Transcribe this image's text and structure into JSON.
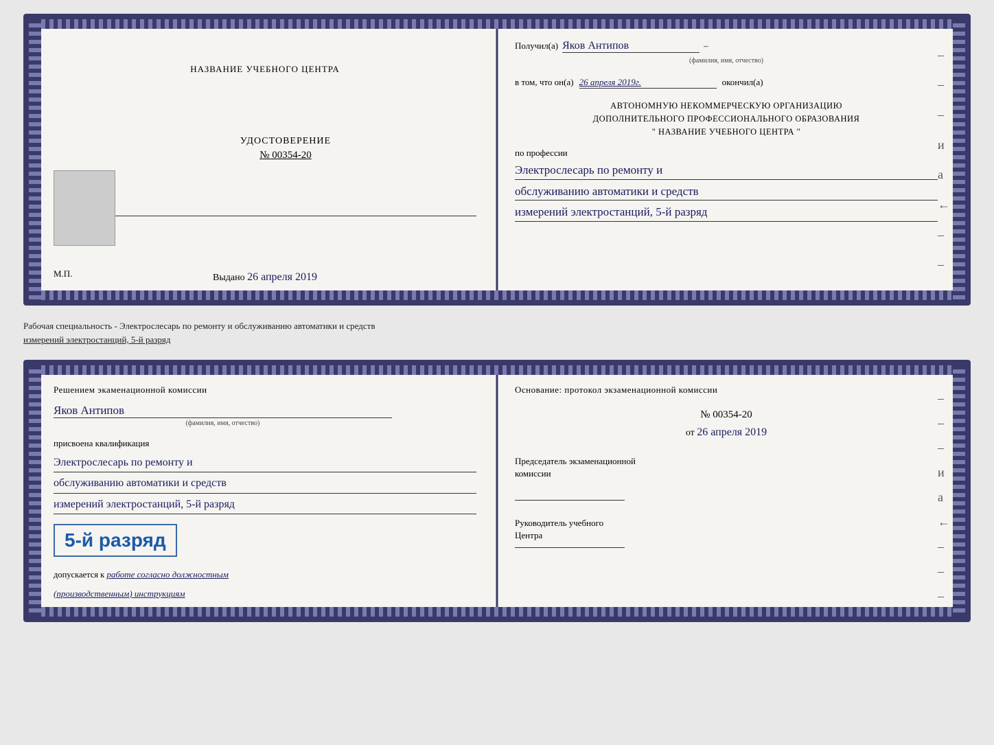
{
  "topDoc": {
    "left": {
      "orgName": "НАЗВАНИЕ УЧЕБНОГО ЦЕНТРА",
      "certTitle": "УДОСТОВЕРЕНИЕ",
      "certNumber": "№ 00354-20",
      "issuedLabel": "Выдано",
      "issuedDate": "26 апреля 2019",
      "mpLabel": "М.П."
    },
    "right": {
      "receivedLabel": "Получил(а)",
      "recipientName": "Яков Антипов",
      "fioSub": "(фамилия, имя, отчество)",
      "certifyText1": "в том, что он(а)",
      "certifyDate": "26 апреля 2019г.",
      "certifyText2": "окончил(а)",
      "orgDesc1": "АВТОНОМНУЮ НЕКОММЕРЧЕСКУЮ ОРГАНИЗАЦИЮ",
      "orgDesc2": "ДОПОЛНИТЕЛЬНОГО ПРОФЕССИОНАЛЬНОГО ОБРАЗОВАНИЯ",
      "orgName": "\"  НАЗВАНИЕ УЧЕБНОГО ЦЕНТРА  \"",
      "professionLabel": "по профессии",
      "profession1": "Электрослесарь по ремонту и",
      "profession2": "обслуживанию автоматики и средств",
      "profession3": "измерений электростанций, 5-й разряд"
    }
  },
  "middleText": {
    "line1": "Рабочая специальность - Электрослесарь по ремонту и обслуживанию автоматики и средств",
    "line2": "измерений электростанций, 5-й разряд"
  },
  "bottomDoc": {
    "left": {
      "commissionTitle": "Решением экаменационной комиссии",
      "name": "Яков Антипов",
      "fioSub": "(фамилия, имя, отчество)",
      "qualificationLabel": "присвоена квалификация",
      "qual1": "Электрослесарь по ремонту и",
      "qual2": "обслуживанию автоматики и средств",
      "qual3": "измерений электростанций, 5-й разряд",
      "rankText": "5-й разряд",
      "allowedLabel": "допускается к",
      "allowedText": "работе согласно должностным",
      "allowedText2": "(производственным) инструкциям"
    },
    "right": {
      "basisLabel": "Основание: протокол экзаменационной комиссии",
      "protocolNumber": "№ 00354-20",
      "datePrefix": "от",
      "date": "26 апреля 2019",
      "chairmanTitle1": "Председатель экзаменационной",
      "chairmanTitle2": "комиссии",
      "directorTitle1": "Руководитель учебного",
      "directorTitle2": "Центра"
    }
  },
  "dashes": [
    "-",
    "-",
    "-",
    "и",
    "а",
    "←",
    "-",
    "-",
    "-",
    "-",
    "-"
  ]
}
